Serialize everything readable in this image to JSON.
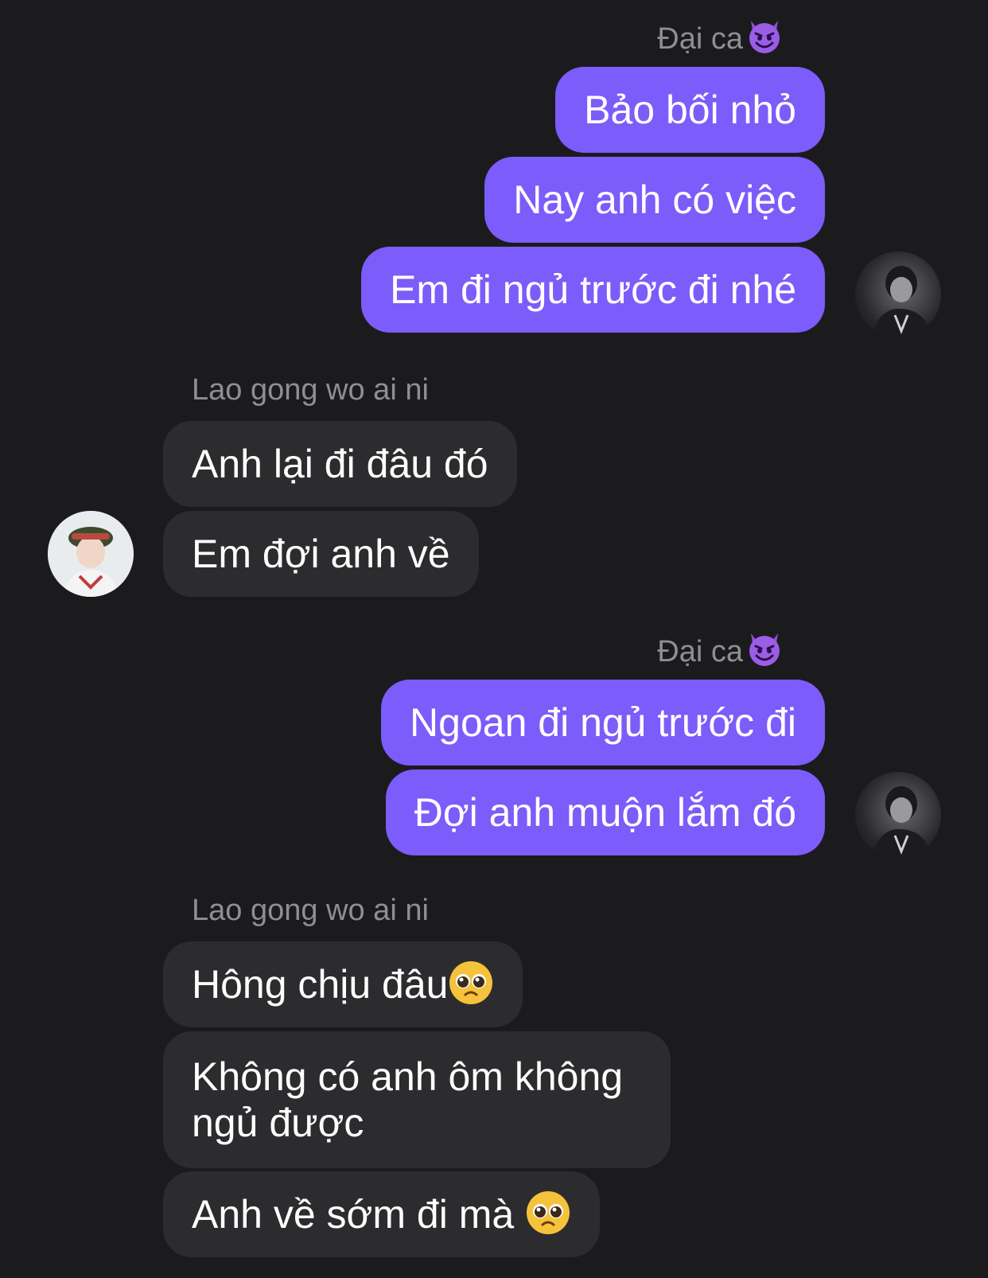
{
  "conversation": {
    "groups": [
      {
        "sender": "Đại ca",
        "direction": "outgoing",
        "messages": [
          "Bảo bối nhỏ",
          "Nay anh có việc",
          "Em đi ngủ trước đi nhé"
        ]
      },
      {
        "sender": "Lao gong wo ai ni",
        "direction": "incoming",
        "messages": [
          "Anh lại đi đâu đó",
          "Em đợi anh về"
        ]
      },
      {
        "sender": "Đại ca",
        "direction": "outgoing",
        "messages": [
          "Ngoan đi ngủ trước đi",
          "Đợi anh muộn lắm đó"
        ]
      },
      {
        "sender": "Lao gong wo ai ni",
        "direction": "incoming",
        "messages": [
          "Hông chịu đâu",
          "Không có anh ôm không ngủ được",
          "Anh về sớm đi mà "
        ]
      }
    ]
  },
  "icons": {
    "sender_emoji": "smiling-devil-emoji-icon",
    "reaction_emoji": "pleading-face-emoji-icon"
  },
  "colors": {
    "background": "#1b1b1e",
    "outgoing_bubble": "#7c5cfa",
    "incoming_bubble": "#2c2c2f",
    "sender_name": "#8e8e93",
    "text": "#ffffff"
  }
}
